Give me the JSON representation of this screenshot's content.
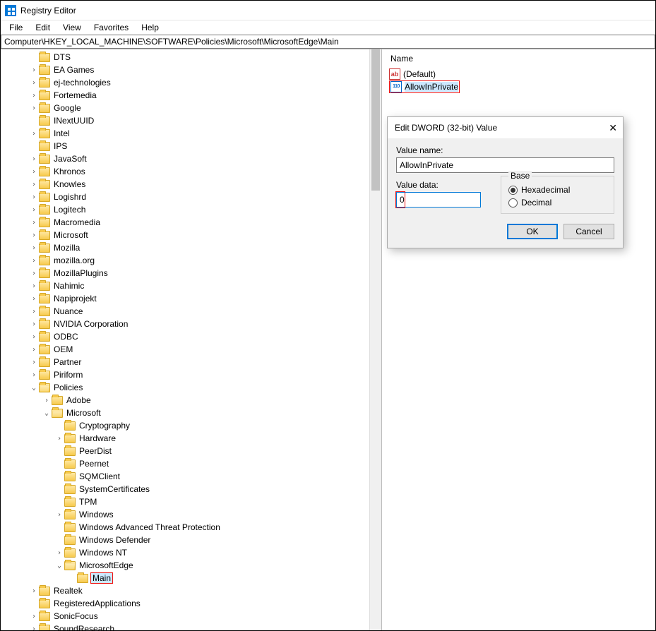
{
  "window": {
    "title": "Registry Editor"
  },
  "menu": {
    "file": "File",
    "edit": "Edit",
    "view": "View",
    "favorites": "Favorites",
    "help": "Help"
  },
  "address_path": "Computer\\HKEY_LOCAL_MACHINE\\SOFTWARE\\Policies\\Microsoft\\MicrosoftEdge\\Main",
  "values_header": "Name",
  "values": [
    {
      "name": "(Default)",
      "type": "sz"
    },
    {
      "name": "AllowInPrivate",
      "type": "dw",
      "selected": true,
      "highlighted": true
    }
  ],
  "dialog": {
    "title": "Edit DWORD (32-bit) Value",
    "value_name_label": "Value name:",
    "value_name": "AllowInPrivate",
    "value_data_label": "Value data:",
    "value_data": "0",
    "base_label": "Base",
    "hex_label": "Hexadecimal",
    "dec_label": "Decimal",
    "base": "hex",
    "ok": "OK",
    "cancel": "Cancel"
  },
  "tree_top": [
    {
      "exp": "",
      "label": "DTS"
    },
    {
      "exp": ">",
      "label": "EA Games"
    },
    {
      "exp": ">",
      "label": "ej-technologies"
    },
    {
      "exp": ">",
      "label": "Fortemedia"
    },
    {
      "exp": ">",
      "label": "Google"
    },
    {
      "exp": "",
      "label": "INextUUID"
    },
    {
      "exp": ">",
      "label": "Intel"
    },
    {
      "exp": "",
      "label": "IPS"
    },
    {
      "exp": ">",
      "label": "JavaSoft"
    },
    {
      "exp": ">",
      "label": "Khronos"
    },
    {
      "exp": ">",
      "label": "Knowles"
    },
    {
      "exp": ">",
      "label": "Logishrd"
    },
    {
      "exp": ">",
      "label": "Logitech"
    },
    {
      "exp": ">",
      "label": "Macromedia"
    },
    {
      "exp": ">",
      "label": "Microsoft"
    },
    {
      "exp": ">",
      "label": "Mozilla"
    },
    {
      "exp": ">",
      "label": "mozilla.org"
    },
    {
      "exp": ">",
      "label": "MozillaPlugins"
    },
    {
      "exp": ">",
      "label": "Nahimic"
    },
    {
      "exp": ">",
      "label": "Napiprojekt"
    },
    {
      "exp": ">",
      "label": "Nuance"
    },
    {
      "exp": ">",
      "label": "NVIDIA Corporation"
    },
    {
      "exp": ">",
      "label": "ODBC"
    },
    {
      "exp": ">",
      "label": "OEM"
    },
    {
      "exp": ">",
      "label": "Partner"
    },
    {
      "exp": ">",
      "label": "Piriform"
    }
  ],
  "policies_label": "Policies",
  "policies_children_top": [
    {
      "exp": ">",
      "label": "Adobe"
    }
  ],
  "microsoft_label": "Microsoft",
  "microsoft_children": [
    {
      "exp": "",
      "label": "Cryptography"
    },
    {
      "exp": ">",
      "label": "Hardware"
    },
    {
      "exp": "",
      "label": "PeerDist"
    },
    {
      "exp": "",
      "label": "Peernet"
    },
    {
      "exp": "",
      "label": "SQMClient"
    },
    {
      "exp": "",
      "label": "SystemCertificates"
    },
    {
      "exp": "",
      "label": "TPM"
    },
    {
      "exp": ">",
      "label": "Windows"
    },
    {
      "exp": "",
      "label": "Windows Advanced Threat Protection"
    },
    {
      "exp": "",
      "label": "Windows Defender"
    },
    {
      "exp": ">",
      "label": "Windows NT"
    }
  ],
  "edge_label": "MicrosoftEdge",
  "main_label": "Main",
  "tree_bottom": [
    {
      "exp": ">",
      "label": "Realtek"
    },
    {
      "exp": "",
      "label": "RegisteredApplications"
    },
    {
      "exp": ">",
      "label": "SonicFocus"
    },
    {
      "exp": ">",
      "label": "SoundResearch"
    }
  ]
}
